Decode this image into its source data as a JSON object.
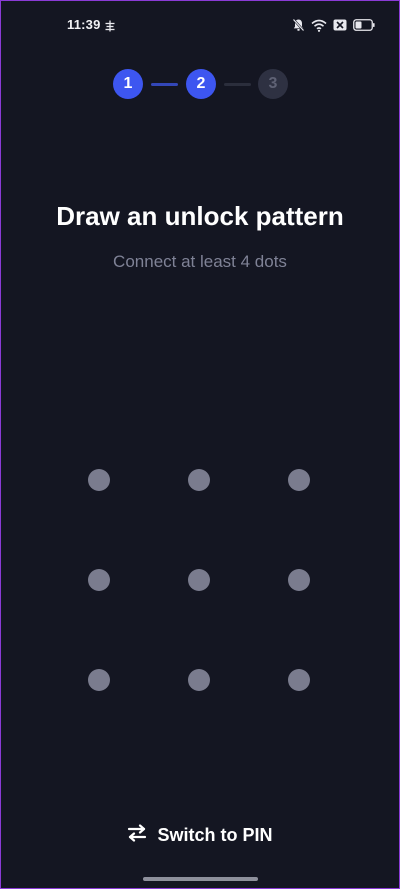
{
  "status_bar": {
    "time": "11:39",
    "icons": [
      "cast-icon",
      "mute-bell-icon",
      "wifi-icon",
      "close-box-icon",
      "battery-icon"
    ]
  },
  "stepper": {
    "steps": [
      {
        "label": "1",
        "state": "active"
      },
      {
        "label": "2",
        "state": "active"
      },
      {
        "label": "3",
        "state": "inactive"
      }
    ],
    "active_color": "#3d56f0",
    "inactive_color": "#2e3142"
  },
  "main": {
    "title": "Draw an unlock pattern",
    "subtitle": "Connect at least 4 dots"
  },
  "pattern": {
    "rows": 3,
    "cols": 3,
    "dot_color": "#7a7c8e"
  },
  "footer": {
    "switch_label": "Switch to PIN",
    "switch_icon": "swap-arrows-icon"
  },
  "colors": {
    "background": "#141622",
    "accent": "#3d56f0"
  }
}
